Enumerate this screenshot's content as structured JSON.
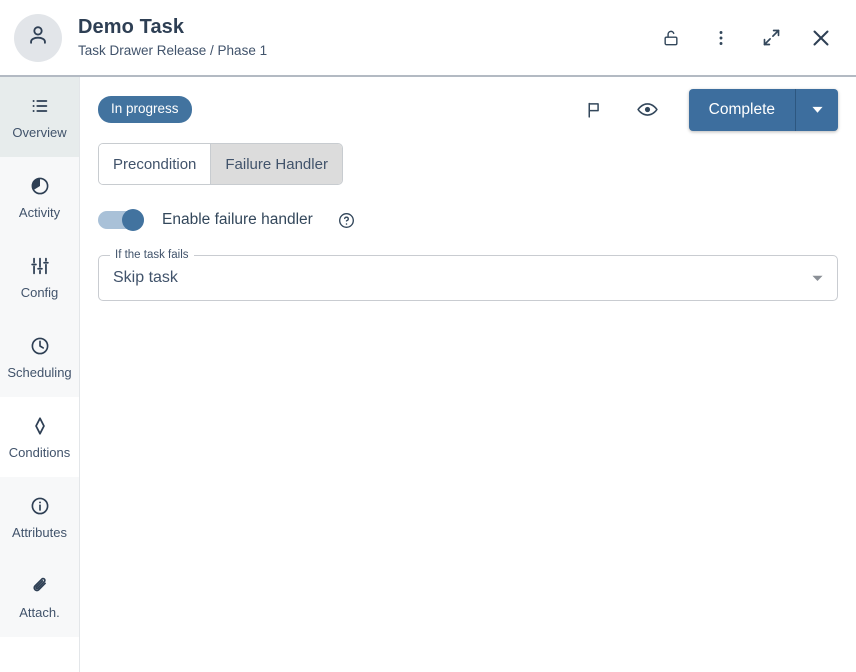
{
  "header": {
    "avatar_icon": "person-icon",
    "title": "Demo Task",
    "subtitle": "Task Drawer Release / Phase 1",
    "actions": [
      {
        "name": "lock-icon",
        "label": "Unlock"
      },
      {
        "name": "more-vertical-icon",
        "label": "More options"
      },
      {
        "name": "expand-icon",
        "label": "Expand"
      },
      {
        "name": "close-icon",
        "label": "Close"
      }
    ]
  },
  "sidebar": {
    "items": [
      {
        "label": "Overview",
        "icon": "list-icon",
        "active": true,
        "shaded": true
      },
      {
        "label": "Activity",
        "icon": "pie-chart-icon",
        "active": false,
        "shaded": true
      },
      {
        "label": "Config",
        "icon": "sliders-icon",
        "active": false,
        "shaded": true
      },
      {
        "label": "Scheduling",
        "icon": "clock-icon",
        "active": false,
        "shaded": true
      },
      {
        "label": "Conditions",
        "icon": "diamond-icon",
        "active": false,
        "shaded": false
      },
      {
        "label": "Attributes",
        "icon": "info-icon",
        "active": false,
        "shaded": true
      },
      {
        "label": "Attach.",
        "icon": "paperclip-icon",
        "active": false,
        "shaded": true
      }
    ]
  },
  "toolbar": {
    "status": "In progress",
    "flag_icon": "flag-icon",
    "watch_icon": "eye-icon",
    "primary_action": "Complete",
    "primary_caret_icon": "chevron-down-icon"
  },
  "tabs": [
    {
      "label": "Precondition",
      "selected": false
    },
    {
      "label": "Failure Handler",
      "selected": true
    }
  ],
  "failure_handler": {
    "toggle_label": "Enable failure handler",
    "toggle_on": true,
    "help_icon": "help-circle-icon",
    "select": {
      "legend": "If the task fails",
      "value": "Skip task",
      "caret_icon": "chevron-down-icon"
    }
  },
  "colors": {
    "accent": "#42739f",
    "primary_button": "#3d6e9e",
    "text": "#33475b",
    "title": "#2e3f54",
    "border": "#c8ccd0",
    "sidebar_shade": "#f7f8f9",
    "active_nav": "#e7ecec",
    "header_divider": "#b3bac3"
  }
}
